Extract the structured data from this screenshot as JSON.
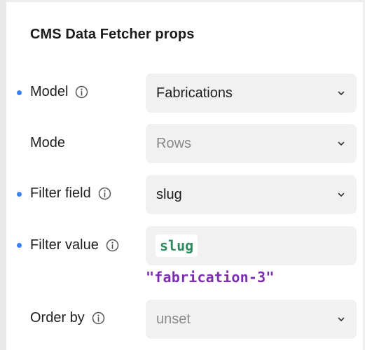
{
  "panel": {
    "title": "CMS Data Fetcher props"
  },
  "props": [
    {
      "label": "Model",
      "value": "Fabrications",
      "has_info": true,
      "set": true
    },
    {
      "label": "Mode",
      "value": "Rows",
      "has_info": false,
      "set": false
    },
    {
      "label": "Filter field",
      "value": "slug",
      "has_info": true,
      "set": true
    },
    {
      "label": "Filter value",
      "chip": "slug",
      "code_value": "\"fabrication-3\"",
      "has_info": true,
      "set": true
    },
    {
      "label": "Order by",
      "value": "unset",
      "has_info": true,
      "set": false
    }
  ],
  "icons": {
    "info": "info-circle-icon",
    "chevron": "chevron-down-icon",
    "set_indicator": "blue-dot-icon"
  },
  "colors": {
    "dot": "#3b82f6",
    "field_bg": "#f1f1f1",
    "code_chip_text": "#2f8a5e",
    "code_value_text": "#7b2fb0",
    "placeholder_text": "#8a8a8a"
  }
}
